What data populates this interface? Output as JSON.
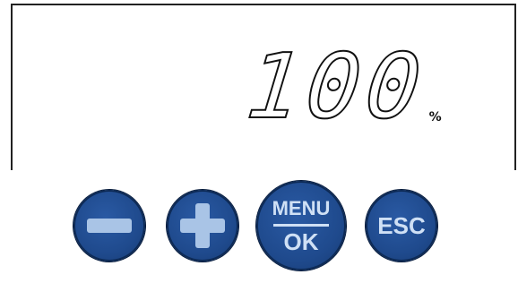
{
  "display": {
    "value": "100",
    "unit": "%"
  },
  "buttons": {
    "menu_label": "MENU",
    "ok_label": "OK",
    "esc_label": "ESC"
  },
  "colors": {
    "button_blue": "#1f4a8d",
    "button_glyph": "#a9c4e6",
    "lcd_border": "#222222"
  },
  "icons": {
    "minus": "minus-icon",
    "plus": "plus-icon"
  }
}
